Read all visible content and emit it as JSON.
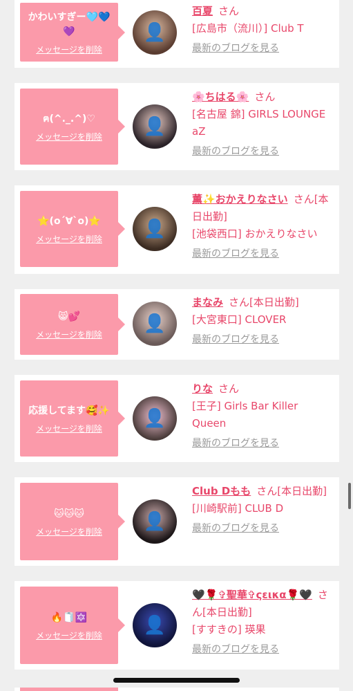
{
  "delete_label": "メッセージを削除",
  "blog_label": "最新のブログを見る",
  "san_label": "さん",
  "colors": {
    "bubble": "#fb9aaa",
    "accent": "#e8476a",
    "link_gray": "#9a9a9a",
    "background": "#efefef"
  },
  "items": [
    {
      "message": "かわいすぎー🩵💙💜",
      "name": "百夏",
      "status": "",
      "shop": "[広島市（流川）] Club T"
    },
    {
      "message": "ฅ(^._.^)♡",
      "name": "🌸ちはる🌸",
      "status": "",
      "shop": "[名古屋 錦] GIRLS LOUNGE aZ"
    },
    {
      "message": "⭐(o´∀`o)⭐",
      "name": "薫✨おかえりなさい",
      "status": "[本日出勤]",
      "shop": "[池袋西口] おかえりなさい"
    },
    {
      "message": "😸💕",
      "name": "まなみ",
      "status": "[本日出勤]",
      "shop": "[大宮東口] CLOVER"
    },
    {
      "message": "応援してます🥰✨",
      "name": "りな",
      "status": "",
      "shop": "[王子] Girls Bar Killer Queen"
    },
    {
      "message": "🐱🐱🐱",
      "name": "Club Dもも",
      "status": "[本日出勤]",
      "shop": "[川崎駅前] CLUB D"
    },
    {
      "message": "🔥🧻🔯",
      "name": "🖤🌹✞聖華✞ςεικα🌹🖤",
      "status": "[本日出勤]",
      "shop": "[すすきの] 瑛果"
    }
  ]
}
